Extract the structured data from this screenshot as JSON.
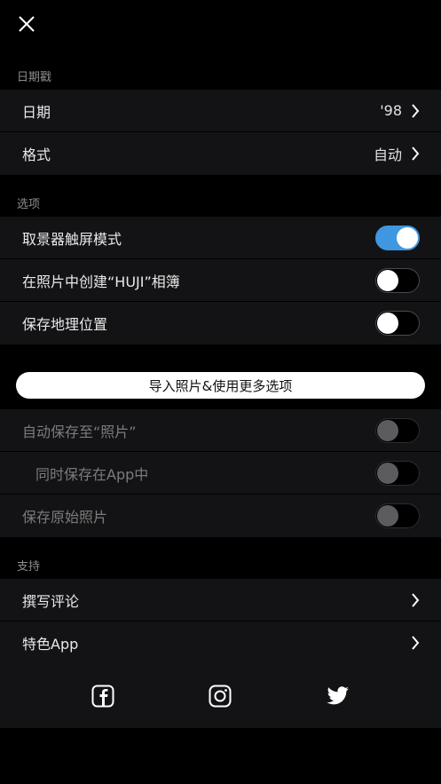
{
  "sections": {
    "datestamp": {
      "header": "日期戳",
      "rows": [
        {
          "label": "日期",
          "value": "'98"
        },
        {
          "label": "格式",
          "value": "自动"
        }
      ]
    },
    "options": {
      "header": "选项",
      "rows": [
        {
          "label": "取景器触屏模式",
          "toggle": true
        },
        {
          "label": "在照片中创建“HUJI”相簿",
          "toggle": false
        },
        {
          "label": "保存地理位置",
          "toggle": false
        }
      ]
    },
    "import_button": "导入照片&使用更多选项",
    "locked": {
      "rows": [
        {
          "label": "自动保存至“照片”",
          "toggle": false
        },
        {
          "label": "同时保存在App中",
          "toggle": false
        },
        {
          "label": "保存原始照片",
          "toggle": false
        }
      ]
    },
    "support": {
      "header": "支持",
      "rows": [
        {
          "label": "撰写评论"
        },
        {
          "label": "特色App"
        }
      ]
    }
  },
  "colors": {
    "background": "#000000",
    "row": "#131315",
    "toggle_on": "#3e97e0"
  },
  "icons": [
    "close-icon",
    "chevron-right-icon",
    "facebook-icon",
    "instagram-icon",
    "twitter-icon"
  ]
}
